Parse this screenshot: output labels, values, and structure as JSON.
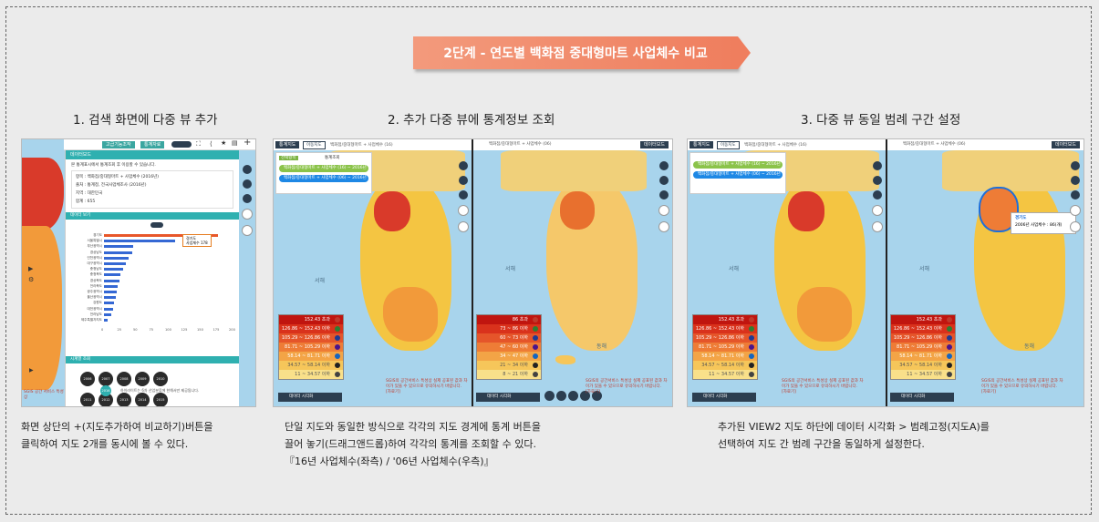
{
  "banner": "2단계 - 연도별 백화점 중대형마트 사업체수 비교",
  "steps": [
    {
      "title": "1. 검색 화면에 다중 뷰 추가",
      "desc1": "화면 상단의 +(지도추가하여 비교하기)버튼을",
      "desc2": "클릭하여 지도 2개를 동시에 볼 수 있다."
    },
    {
      "title": "2. 추가 다중 뷰에 통계정보 조회",
      "desc1": "단일 지도와 동일한 방식으로 각각의 지도 경계에 통계 버튼을",
      "desc2": "끌어 놓기(드래그앤드롭)하여 각각의 통계를 조회할 수 있다.",
      "desc3": "『16년 사업체수(좌측) / '06년 사업체수(우측)』"
    },
    {
      "title": "3. 다중 뷰 동일 범례 구간 설정",
      "desc1": "추가된 VIEW2 지도 하단에 데이터 시각화 > 범례고정(지도A)를",
      "desc2": "선택하여 지도 간 범례 구간을 동일하게 설정한다."
    }
  ],
  "shot1": {
    "tab_a": "고급기능조작",
    "tab_b": "통계자료",
    "panel_title": "데이터보드",
    "info": "본 통계표시에서 통계조회 후 이용할 수 있습니다.",
    "field_item": "항목 : 백화점/중대형마트 + 사업체수 (2016년)",
    "field_source": "출처 : 통계청, 전국사업체조사 (2016년)",
    "field_region": "지역 : 대한민국",
    "field_total": "합계 : 655",
    "section_chart": "데이터 보기",
    "tooltip1": "경기도",
    "tooltip2": "사업체수 178",
    "regions": [
      "경기도",
      "서울특별시",
      "부산광역시",
      "경상남도",
      "인천광역시",
      "대구광역시",
      "충청남도",
      "충청북도",
      "경상북도",
      "전라북도",
      "광주광역시",
      "울산광역시",
      "강원도",
      "대전광역시",
      "전라남도",
      "제주특별자치도"
    ],
    "values": [
      178,
      112,
      46,
      44,
      38,
      34,
      30,
      26,
      24,
      22,
      20,
      18,
      16,
      14,
      12,
      6
    ],
    "xticks": [
      "0",
      "25",
      "50",
      "75",
      "100",
      "125",
      "150",
      "175",
      "200"
    ],
    "section_years": "시계열 조회",
    "years": [
      "2006",
      "2007",
      "2008",
      "2009",
      "2010",
      "2011",
      "2012",
      "2013",
      "2014",
      "2015"
    ],
    "note": "하이라이트는 6차 산업분류에 한해서만 제공됩니다.",
    "year_btn": "2016"
  },
  "shot2": {
    "left_btn": "통계지도",
    "left_tab": "이동지도",
    "left_path": "백화점/중대형마트 + 사업체수 (16)",
    "right_path": "백화점/중대형마트 + 사업체수 (06)",
    "right_btn": "데이터보드",
    "filter_title": "선택항목",
    "filter_sub": "통계조회",
    "pill1": "백화점/중대형마트 + 사업체수 (16) ~ 2016년",
    "pill2": "백화점/중대형마트 + 사업체수 (06) ~ 2016년",
    "sea_label": "서해",
    "east_label": "동해",
    "legend_left": [
      "152.43 초과",
      "126.86 ~ 152.43 이하",
      "105.29 ~ 126.86 이하",
      "81.71 ~ 105.29 이하",
      "58.14 ~ 81.71 이하",
      "34.57 ~ 58.14 이하",
      "11 ~ 34.57 이하"
    ],
    "legend_right": [
      "86 초과",
      "73 ~ 86 이하",
      "60 ~ 73 이하",
      "47 ~ 60 이하",
      "34 ~ 47 이하",
      "21 ~ 34 이하",
      "8 ~ 21 이하"
    ],
    "legend_btn": "데이터 시각화",
    "warning": "SGIS의 공간서비스 특성상 실제 공표된 값과 차이가 있을 수 있으므로 유의하시기 바랍니다. [자료기]"
  },
  "shot3": {
    "left_btn": "통계지도",
    "left_tab": "이동지도",
    "left_path": "백화점/중대형마트 + 사업체수 (16)",
    "right_path": "백화점/중대형마트 + 사업체수 (06)",
    "right_btn": "데이터보드",
    "pill1": "백화점/중대형마트 + 사업체수 (16) ~ 2016년",
    "pill2": "백화점/중대형마트 + 사업체수 (06) ~ 2016년",
    "sea_label": "서해",
    "east_label": "동해",
    "popup_title": "경기도",
    "popup_text": "2006년 사업체수 : 86(개)",
    "legend": [
      "152.43 초과",
      "126.86 ~ 152.43 이하",
      "105.29 ~ 126.86 이하",
      "81.71 ~ 105.29 이하",
      "58.14 ~ 81.71 이하",
      "34.57 ~ 58.14 이하",
      "11 ~ 34.57 이하"
    ],
    "legend_btn": "데이터 시각화",
    "warning": "SGIS의 공간서비스 특성상 실제 공표된 값과 차이가 있을 수 있으므로 유의하시기 바랍니다. [자료기]"
  },
  "colors": {
    "legend": [
      "#c0150f",
      "#d9321c",
      "#e5552a",
      "#ee7c36",
      "#f3a446",
      "#f6c65a",
      "#f9e08a"
    ],
    "dots": [
      "#c0392b",
      "#2e7d32",
      "#1f3a93",
      "#4a148c",
      "#1565c0",
      "#212121",
      "#424242"
    ]
  }
}
